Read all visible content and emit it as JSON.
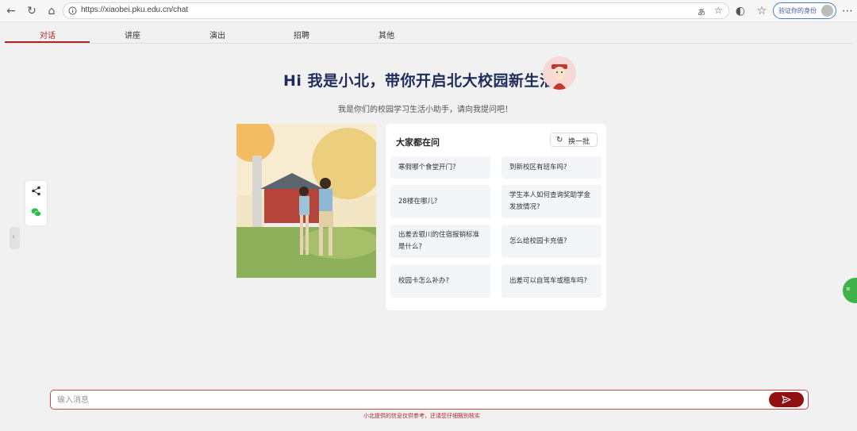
{
  "browser": {
    "url": "https://xiaobei.pku.edu.cn/chat",
    "verify_label": "验证你的身份"
  },
  "tabs": [
    {
      "label": "对话",
      "active": true
    },
    {
      "label": "讲座",
      "active": false
    },
    {
      "label": "演出",
      "active": false
    },
    {
      "label": "招聘",
      "active": false
    },
    {
      "label": "其他",
      "active": false
    }
  ],
  "hero": {
    "title": "Hi  我是小北，带你开启北大校园新生活",
    "subtitle": "我是你们的校园学习生活小助手，请向我提问吧！"
  },
  "faq": {
    "title": "大家都在问",
    "refresh_label": "换一批",
    "items": [
      "寒假哪个食堂开门?",
      "到新校区有班车吗?",
      "28楼在哪儿?",
      "学生本人如何查询奖助学金发放情况?",
      "出差去银川的住宿报销标准是什么?",
      "怎么给校园卡充值?",
      "校园卡怎么补办?",
      "出差可以自驾车或租车吗?"
    ]
  },
  "chat": {
    "placeholder": "输入消息",
    "disclaimer": "小北提供的信息仅供参考，还请您仔细甄别核实"
  },
  "colors": {
    "accent": "#b32424",
    "title": "#1f2d5a",
    "send": "#8f1010"
  }
}
